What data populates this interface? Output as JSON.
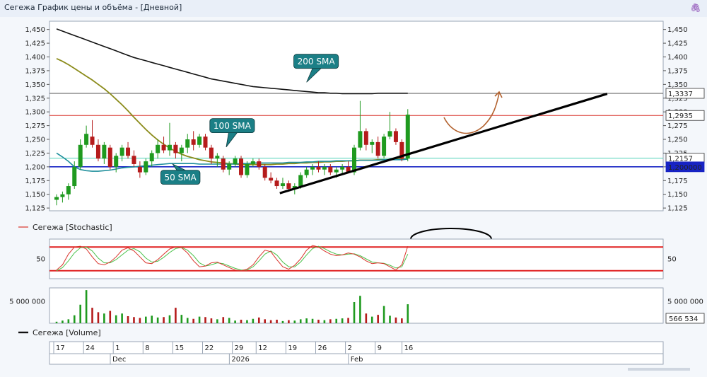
{
  "window": {
    "title": "Сегежа График цены и объёма - [Дневной]"
  },
  "colors": {
    "up": "#1f9a1f",
    "down": "#b51b1b",
    "sma50": "#1f8f9c",
    "sma100": "#8b8b1a",
    "sma200": "#111111",
    "callout": "#1b7f86",
    "stoch_k": "#d9342b",
    "stoch_d": "#4cc24c"
  },
  "chart_data": [
    {
      "type": "candlestick",
      "ylim": [
        1.12,
        1.465
      ],
      "yticks": [
        "1,450",
        "1,425",
        "1,400",
        "1,375",
        "1,350",
        "1,325",
        "1,300",
        "1,275",
        "1,250",
        "1,225",
        "1,200",
        "1,175",
        "1,150",
        "1,125"
      ],
      "ytick_values": [
        1.45,
        1.425,
        1.4,
        1.375,
        1.35,
        1.325,
        1.3,
        1.275,
        1.25,
        1.225,
        1.2,
        1.175,
        1.15,
        1.125
      ],
      "sessions": 60,
      "ohlc": [
        [
          1.14,
          1.15,
          1.13,
          1.145
        ],
        [
          1.145,
          1.155,
          1.135,
          1.15
        ],
        [
          1.15,
          1.17,
          1.14,
          1.165
        ],
        [
          1.165,
          1.21,
          1.16,
          1.2
        ],
        [
          1.2,
          1.25,
          1.195,
          1.24
        ],
        [
          1.24,
          1.275,
          1.235,
          1.26
        ],
        [
          1.255,
          1.285,
          1.235,
          1.24
        ],
        [
          1.24,
          1.25,
          1.21,
          1.215
        ],
        [
          1.215,
          1.245,
          1.205,
          1.24
        ],
        [
          1.235,
          1.24,
          1.195,
          1.2
        ],
        [
          1.2,
          1.225,
          1.19,
          1.22
        ],
        [
          1.22,
          1.24,
          1.21,
          1.235
        ],
        [
          1.235,
          1.245,
          1.215,
          1.22
        ],
        [
          1.22,
          1.23,
          1.2,
          1.205
        ],
        [
          1.2,
          1.21,
          1.18,
          1.19
        ],
        [
          1.19,
          1.215,
          1.185,
          1.21
        ],
        [
          1.21,
          1.23,
          1.2,
          1.225
        ],
        [
          1.225,
          1.25,
          1.215,
          1.24
        ],
        [
          1.24,
          1.255,
          1.225,
          1.23
        ],
        [
          1.23,
          1.28,
          1.22,
          1.24
        ],
        [
          1.24,
          1.245,
          1.215,
          1.225
        ],
        [
          1.225,
          1.24,
          1.21,
          1.235
        ],
        [
          1.235,
          1.26,
          1.225,
          1.25
        ],
        [
          1.25,
          1.265,
          1.23,
          1.24
        ],
        [
          1.24,
          1.26,
          1.235,
          1.255
        ],
        [
          1.255,
          1.26,
          1.23,
          1.235
        ],
        [
          1.235,
          1.24,
          1.205,
          1.215
        ],
        [
          1.215,
          1.225,
          1.2,
          1.22
        ],
        [
          1.215,
          1.22,
          1.19,
          1.195
        ],
        [
          1.195,
          1.21,
          1.185,
          1.205
        ],
        [
          1.205,
          1.22,
          1.2,
          1.215
        ],
        [
          1.215,
          1.22,
          1.18,
          1.185
        ],
        [
          1.185,
          1.21,
          1.18,
          1.205
        ],
        [
          1.205,
          1.215,
          1.2,
          1.21
        ],
        [
          1.21,
          1.215,
          1.195,
          1.2
        ],
        [
          1.2,
          1.205,
          1.175,
          1.18
        ],
        [
          1.18,
          1.19,
          1.17,
          1.175
        ],
        [
          1.175,
          1.18,
          1.16,
          1.165
        ],
        [
          1.165,
          1.18,
          1.16,
          1.17
        ],
        [
          1.17,
          1.175,
          1.155,
          1.16
        ],
        [
          1.16,
          1.17,
          1.15,
          1.165
        ],
        [
          1.165,
          1.19,
          1.16,
          1.185
        ],
        [
          1.185,
          1.2,
          1.18,
          1.195
        ],
        [
          1.195,
          1.205,
          1.185,
          1.2
        ],
        [
          1.2,
          1.21,
          1.19,
          1.195
        ],
        [
          1.195,
          1.205,
          1.185,
          1.2
        ],
        [
          1.2,
          1.205,
          1.185,
          1.19
        ],
        [
          1.19,
          1.2,
          1.18,
          1.195
        ],
        [
          1.195,
          1.205,
          1.185,
          1.2
        ],
        [
          1.2,
          1.21,
          1.19,
          1.19
        ],
        [
          1.19,
          1.24,
          1.185,
          1.235
        ],
        [
          1.235,
          1.32,
          1.23,
          1.265
        ],
        [
          1.265,
          1.27,
          1.23,
          1.24
        ],
        [
          1.24,
          1.25,
          1.225,
          1.245
        ],
        [
          1.245,
          1.255,
          1.215,
          1.22
        ],
        [
          1.22,
          1.26,
          1.215,
          1.255
        ],
        [
          1.255,
          1.3,
          1.25,
          1.265
        ],
        [
          1.265,
          1.27,
          1.24,
          1.245
        ],
        [
          1.245,
          1.25,
          1.21,
          1.215
        ],
        [
          1.215,
          1.305,
          1.21,
          1.295
        ]
      ],
      "sma50": [
        1.225,
        1.218,
        1.21,
        1.2,
        1.195,
        1.193,
        1.192,
        1.192,
        1.193,
        1.194,
        1.196,
        1.198,
        1.199,
        1.2,
        1.201,
        1.202,
        1.203,
        1.204,
        1.205,
        1.206,
        1.206,
        1.206,
        1.206,
        1.206,
        1.205,
        1.205,
        1.205,
        1.205,
        1.205,
        1.205,
        1.205,
        1.206,
        1.206,
        1.207,
        1.207,
        1.207,
        1.207,
        1.207,
        1.207,
        1.208,
        1.208,
        1.208,
        1.209,
        1.209,
        1.21,
        1.21,
        1.21,
        1.211,
        1.211,
        1.211,
        1.211,
        1.212,
        1.212,
        1.212,
        1.212,
        1.213,
        1.213,
        1.213,
        1.213,
        1.214
      ],
      "sma100": [
        1.397,
        1.392,
        1.386,
        1.379,
        1.372,
        1.365,
        1.358,
        1.35,
        1.342,
        1.333,
        1.323,
        1.313,
        1.302,
        1.29,
        1.279,
        1.268,
        1.258,
        1.249,
        1.241,
        1.234,
        1.228,
        1.223,
        1.219,
        1.216,
        1.213,
        1.211,
        1.209,
        1.208,
        1.207,
        1.206,
        1.205,
        1.204,
        1.204,
        1.204,
        1.204,
        1.204,
        1.204,
        1.205,
        1.205,
        1.206,
        1.206,
        1.207,
        1.207,
        1.208,
        1.208,
        1.209,
        1.209,
        1.21,
        1.21,
        1.211,
        1.211,
        1.212,
        1.212,
        1.212,
        1.213,
        1.213,
        1.213,
        1.214,
        1.214,
        1.214
      ],
      "sma200": [
        1.451,
        1.447,
        1.443,
        1.439,
        1.435,
        1.431,
        1.427,
        1.423,
        1.419,
        1.415,
        1.411,
        1.407,
        1.403,
        1.399,
        1.396,
        1.393,
        1.39,
        1.387,
        1.384,
        1.381,
        1.378,
        1.375,
        1.372,
        1.369,
        1.366,
        1.363,
        1.36,
        1.358,
        1.356,
        1.354,
        1.352,
        1.35,
        1.348,
        1.346,
        1.345,
        1.344,
        1.343,
        1.342,
        1.341,
        1.34,
        1.339,
        1.338,
        1.337,
        1.336,
        1.335,
        1.335,
        1.334,
        1.334,
        1.333,
        1.333,
        1.333,
        1.333,
        1.333,
        1.333,
        1.334,
        1.334,
        1.334,
        1.334,
        1.334,
        1.334
      ],
      "hlines": [
        {
          "value": 1.3337,
          "label": "1,3337"
        },
        {
          "value": 1.2935,
          "label": "1,2935"
        },
        {
          "value": 1.2157,
          "label": "1,2157"
        },
        {
          "value": 1.2,
          "label": "1,200000"
        }
      ],
      "trendline": {
        "from": [
          37.5,
          1.152
        ],
        "to": [
          92.5,
          1.333
        ]
      },
      "annotations": [
        {
          "text": "200 SMA",
          "at": [
            43.6,
            1.392
          ],
          "tip": [
            42,
            1.354
          ]
        },
        {
          "text": "100 SMA",
          "at": [
            29.5,
            1.275
          ],
          "tip": [
            28.5,
            1.236
          ]
        },
        {
          "text": "50 SMA",
          "at": [
            20.8,
            1.181
          ],
          "tip": [
            19.5,
            1.205
          ]
        }
      ]
    },
    {
      "type": "line",
      "legend": "Сегежа [Stochastic]",
      "ylim": [
        0,
        100
      ],
      "ytick": {
        "value": 50,
        "label": "50"
      },
      "levels": [
        80,
        20
      ],
      "series_k": [
        22,
        35,
        62,
        80,
        82,
        75,
        55,
        38,
        35,
        42,
        55,
        72,
        78,
        70,
        55,
        40,
        38,
        48,
        62,
        75,
        80,
        78,
        65,
        45,
        30,
        32,
        40,
        42,
        35,
        28,
        22,
        20,
        24,
        35,
        55,
        72,
        68,
        48,
        30,
        24,
        34,
        50,
        72,
        84,
        80,
        70,
        62,
        58,
        60,
        65,
        62,
        55,
        45,
        38,
        40,
        38,
        30,
        22,
        35,
        82
      ],
      "series_d": [
        20,
        28,
        45,
        65,
        78,
        80,
        70,
        52,
        40,
        40,
        48,
        60,
        72,
        76,
        68,
        52,
        42,
        44,
        54,
        66,
        76,
        79,
        72,
        58,
        40,
        32,
        35,
        40,
        38,
        32,
        26,
        22,
        22,
        30,
        45,
        62,
        70,
        60,
        42,
        30,
        30,
        42,
        60,
        76,
        82,
        76,
        68,
        62,
        60,
        62,
        63,
        58,
        50,
        42,
        40,
        39,
        34,
        27,
        30,
        62
      ]
    },
    {
      "type": "bar",
      "legend": "Сегежа [Volume]",
      "ylim": [
        0,
        8000000
      ],
      "ytick": {
        "value": 5000000,
        "label": "5 000 000"
      },
      "last_label": "566 534",
      "values": [
        350000,
        600000,
        900000,
        1800000,
        4200000,
        7500000,
        3500000,
        2500000,
        2200000,
        2800000,
        1800000,
        2200000,
        1600000,
        1400000,
        1200000,
        1500000,
        1700000,
        1300000,
        1400000,
        1800000,
        3500000,
        1900000,
        1200000,
        1000000,
        1500000,
        1400000,
        1100000,
        900000,
        1400000,
        1200000,
        600000,
        800000,
        700000,
        1000000,
        1300000,
        900000,
        700000,
        800000,
        500000,
        700000,
        600000,
        900000,
        1100000,
        1000000,
        800000,
        700000,
        900000,
        1000000,
        1100000,
        1200000,
        4800000,
        6200000,
        2200000,
        1500000,
        1900000,
        3900000,
        1700000,
        1300000,
        1100000,
        4300000
      ],
      "up": [
        true,
        true,
        true,
        true,
        true,
        true,
        false,
        false,
        true,
        false,
        true,
        true,
        false,
        false,
        false,
        true,
        true,
        true,
        false,
        true,
        false,
        true,
        true,
        false,
        true,
        false,
        false,
        true,
        false,
        true,
        true,
        false,
        true,
        true,
        false,
        false,
        false,
        false,
        true,
        false,
        true,
        true,
        true,
        true,
        false,
        true,
        false,
        true,
        true,
        false,
        true,
        true,
        false,
        true,
        false,
        true,
        true,
        false,
        false,
        true
      ]
    },
    {
      "type": "axis",
      "dates": [
        "17",
        "24",
        "1",
        "8",
        "15",
        "22",
        "29",
        "12",
        "19",
        "26",
        "2",
        "9",
        "16"
      ],
      "date_sessions": [
        0,
        5,
        10,
        15,
        20,
        25,
        30,
        34,
        39,
        44,
        49,
        54,
        58.5
      ],
      "months": [
        "Dec",
        "2026",
        "Feb"
      ],
      "month_sessions": [
        9.5,
        29.5,
        49.5
      ]
    }
  ]
}
